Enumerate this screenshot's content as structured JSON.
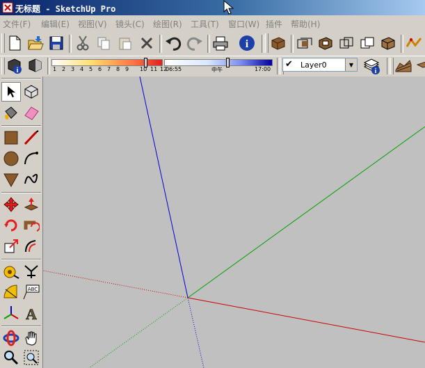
{
  "window": {
    "title": "无标题 - SketchUp Pro"
  },
  "menu": {
    "items": [
      {
        "label": "文件(F)"
      },
      {
        "label": "编辑(E)"
      },
      {
        "label": "视图(V)"
      },
      {
        "label": "镜头(C)"
      },
      {
        "label": "绘图(R)"
      },
      {
        "label": "工具(T)"
      },
      {
        "label": "窗口(W)"
      },
      {
        "label": "插件"
      },
      {
        "label": "帮助(H)"
      }
    ]
  },
  "shadow_bar": {
    "month_ticks": [
      "1",
      "2",
      "3",
      "4",
      "5",
      "6",
      "7",
      "8",
      "9",
      "10",
      "11",
      "12"
    ],
    "time_start": "06:55",
    "time_noon": "中午",
    "time_end": "17:00"
  },
  "layer": {
    "current": "Layer0"
  },
  "colors": {
    "viewport_bg": "#c0c0c0",
    "axis_red": "#cc0000",
    "axis_green": "#00a000",
    "axis_blue": "#0000cc"
  },
  "icons": {
    "top_toolbar": [
      "new-file-icon",
      "open-folder-icon",
      "save-icon",
      "cut-icon",
      "copy-icon",
      "paste-icon",
      "erase-icon",
      "undo-icon",
      "redo-icon",
      "print-icon",
      "model-info-icon",
      "component-icon",
      "section-view-icon",
      "section-plane-icon",
      "wireframe-icon",
      "hidden-line-icon",
      "shaded-icon",
      "sandbox-icon"
    ],
    "left_toolbar": [
      "select-icon",
      "make-component-icon",
      "paint-bucket-icon",
      "eraser-icon",
      "rectangle-icon",
      "line-icon",
      "circle-icon",
      "arc-icon",
      "polygon-icon",
      "freehand-icon",
      "move-icon",
      "push-pull-icon",
      "rotate-icon",
      "follow-me-icon",
      "scale-icon",
      "offset-icon",
      "tape-measure-icon",
      "dimension-icon",
      "protractor-icon",
      "text-icon",
      "axes-icon",
      "3d-text-icon",
      "orbit-icon",
      "pan-icon",
      "zoom-icon",
      "zoom-window-icon"
    ]
  }
}
